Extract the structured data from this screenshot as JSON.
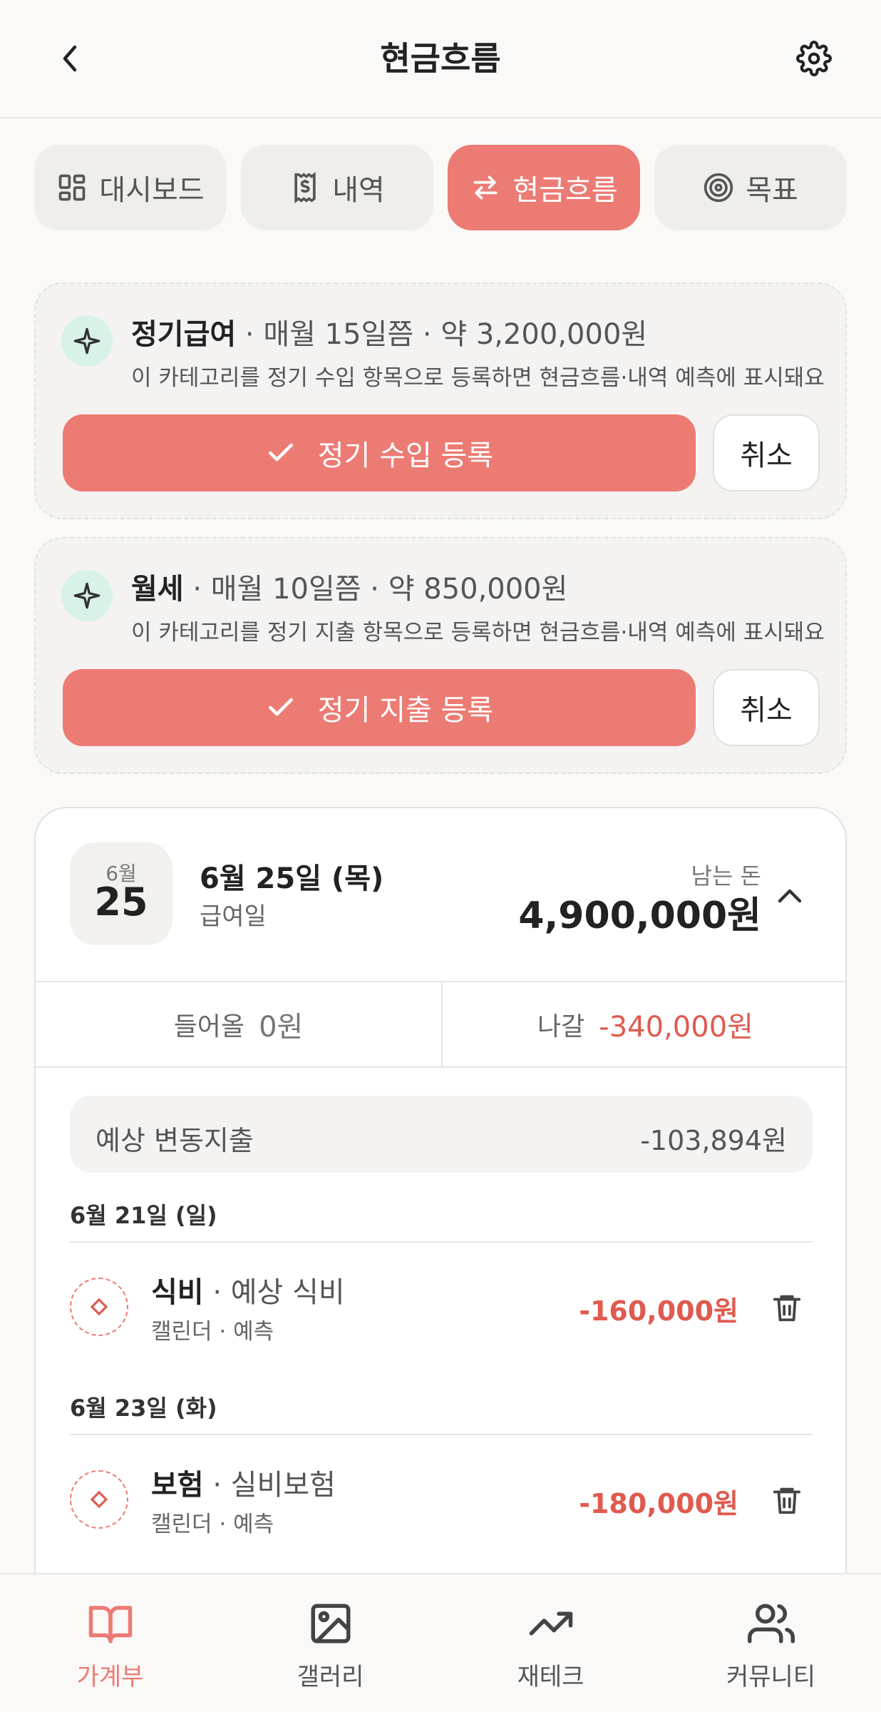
{
  "header": {
    "title": "현금흐름"
  },
  "tabs": [
    {
      "label": "대시보드",
      "icon": "dashboard-icon"
    },
    {
      "label": "내역",
      "icon": "receipt-icon"
    },
    {
      "label": "현금흐름",
      "icon": "swap-icon",
      "active": true
    },
    {
      "label": "목표",
      "icon": "target-icon"
    }
  ],
  "suggestions": [
    {
      "name": "정기급여",
      "detail": " · 매월 15일쯤 · 약 3,200,000원",
      "desc": "이 카테고리를 정기 수입 항목으로 등록하면 현금흐름·내역 예측에 표시돼요",
      "confirm_label": "정기 수입 등록",
      "cancel_label": "취소"
    },
    {
      "name": "월세",
      "detail": " · 매월 10일쯤 · 약 850,000원",
      "desc": "이 카테고리를 정기 지출 항목으로 등록하면 현금흐름·내역 예측에 표시돼요",
      "confirm_label": "정기 지출 등록",
      "cancel_label": "취소"
    }
  ],
  "day_card": {
    "month": "6월",
    "day": "25",
    "title": "6월 25일 (목)",
    "subtitle": "급여일",
    "remaining_label": "남는 돈",
    "remaining_value": "4,900,000원",
    "income_label": "들어올",
    "income_value": "0원",
    "expense_label": "나갈",
    "expense_value": "-340,000원",
    "variable_label": "예상 변동지출",
    "variable_value": "-103,894원",
    "groups": [
      {
        "date": "6월 21일 (일)",
        "items": [
          {
            "name": "식비",
            "detail": " · 예상 식비",
            "sub": "캘린더 · 예측",
            "amount": "-160,000원"
          }
        ]
      },
      {
        "date": "6월 23일 (화)",
        "items": [
          {
            "name": "보험",
            "detail": " · 실비보험",
            "sub": "캘린더 · 예측",
            "amount": "-180,000원"
          }
        ]
      }
    ]
  },
  "bottom_nav": [
    {
      "label": "가계부",
      "icon": "book-icon",
      "active": true
    },
    {
      "label": "갤러리",
      "icon": "image-icon"
    },
    {
      "label": "재테크",
      "icon": "trending-up-icon"
    },
    {
      "label": "커뮤니티",
      "icon": "users-icon"
    }
  ],
  "colors": {
    "accent": "#ec7b74",
    "negative": "#e05a4f",
    "spark_bg": "#d9f2e8"
  }
}
